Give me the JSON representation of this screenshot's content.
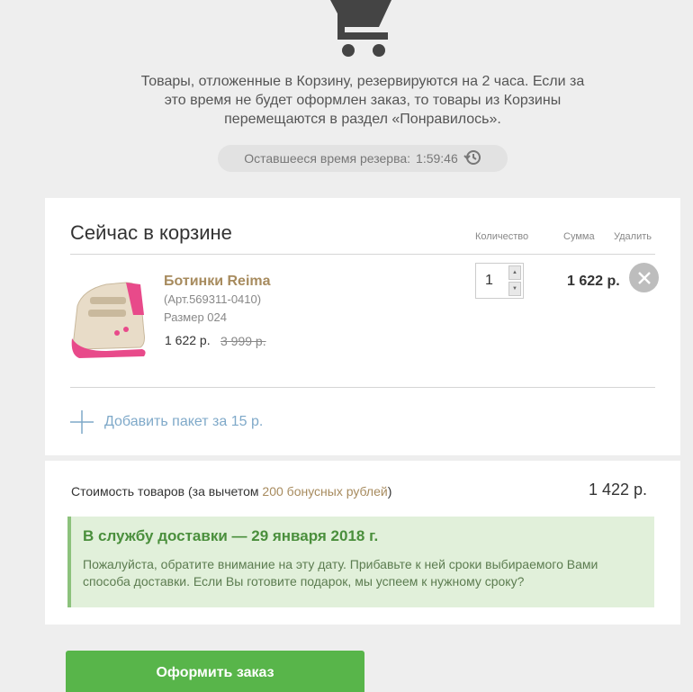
{
  "notice": {
    "line1": "Товары, отложенные в Корзину, резервируются на 2 часа. Если за",
    "line2": "это время не будет оформлен заказ, то товары из Корзины",
    "line3": "перемещаются в раздел «Понравилось»."
  },
  "timer": {
    "label": "Оставшееся время резерва:",
    "value": "1:59:46",
    "icon": "history-clock-icon"
  },
  "cart": {
    "title": "Сейчас в корзине",
    "col_qty": "Количество",
    "col_sum": "Сумма",
    "col_delete": "Удалить",
    "item": {
      "name": "Ботинки Reima",
      "article": "(Арт.569311-0410)",
      "size": "Размер 024",
      "price": "1 622 р.",
      "old_price": "3 999 р.",
      "qty": "1",
      "sum": "1 622 р."
    },
    "add_bag": "Добавить пакет за 15 р."
  },
  "summary": {
    "label_prefix": "Стоимость товаров (за вычетом ",
    "bonus": "200 бонусных рублей",
    "label_suffix": ")",
    "total": "1 422 р."
  },
  "delivery": {
    "title": "В службу доставки — 29 января 2018 г.",
    "text": "Пожалуйста, обратите внимание на эту дату. Прибавьте к ней сроки выбираемого Вами способа доставки. Если Вы готовите подарок, мы успеем к нужному сроку?"
  },
  "checkout_label": "Оформить заказ",
  "colors": {
    "accent_brown": "#a78b5e",
    "green": "#58b54a",
    "link_blue": "#7fa9c9"
  }
}
